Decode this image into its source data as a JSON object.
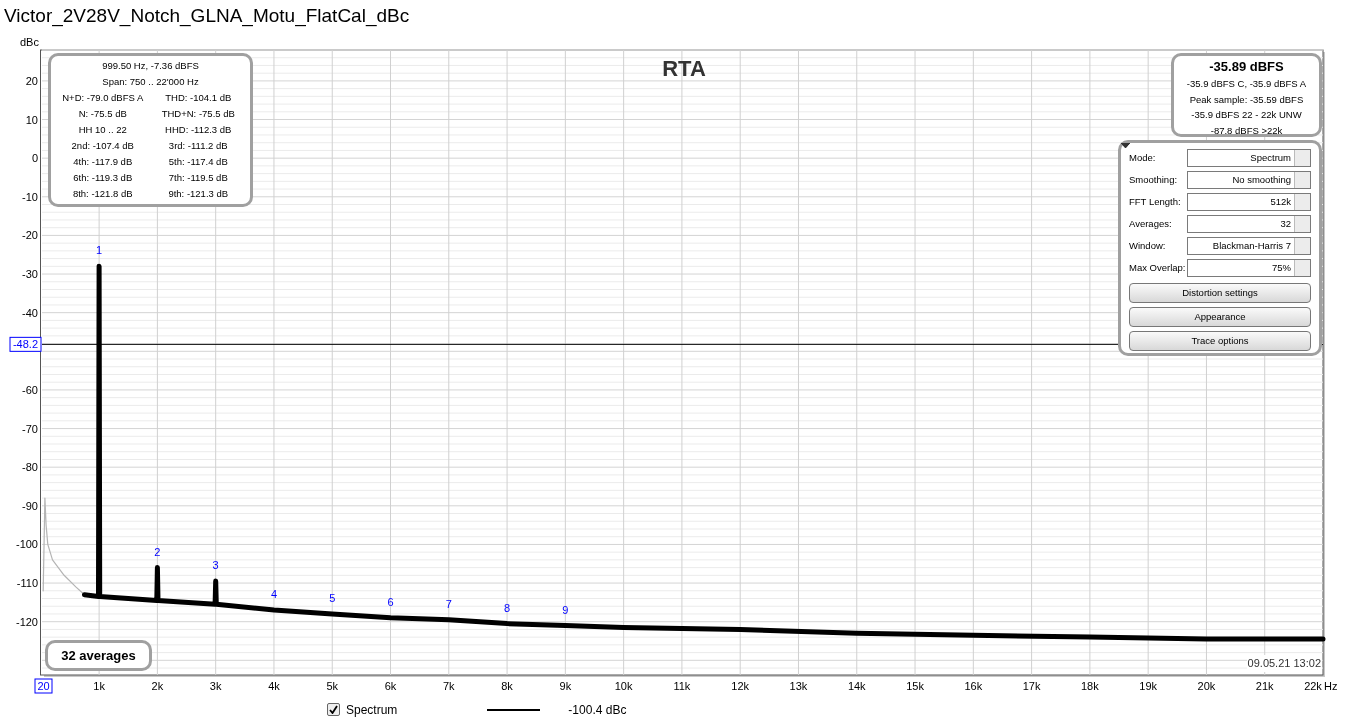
{
  "window": {
    "title": "Victor_2V28V_Notch_GLNA_Motu_FlatCal_dBc"
  },
  "plot": {
    "chart_data": {
      "type": "line",
      "title": "RTA",
      "ylabel": "dBc",
      "xlabel": "Hz",
      "grid": true,
      "xlim": [
        20,
        22000
      ],
      "ylim": [
        -133.8,
        28
      ],
      "xticks": [
        {
          "value": 20,
          "label": "20"
        },
        {
          "value": 1000,
          "label": "1k"
        },
        {
          "value": 2000,
          "label": "2k"
        },
        {
          "value": 3000,
          "label": "3k"
        },
        {
          "value": 4000,
          "label": "4k"
        },
        {
          "value": 5000,
          "label": "5k"
        },
        {
          "value": 6000,
          "label": "6k"
        },
        {
          "value": 7000,
          "label": "7k"
        },
        {
          "value": 8000,
          "label": "8k"
        },
        {
          "value": 9000,
          "label": "9k"
        },
        {
          "value": 10000,
          "label": "10k"
        },
        {
          "value": 11000,
          "label": "11k"
        },
        {
          "value": 12000,
          "label": "12k"
        },
        {
          "value": 13000,
          "label": "13k"
        },
        {
          "value": 14000,
          "label": "14k"
        },
        {
          "value": 15000,
          "label": "15k"
        },
        {
          "value": 16000,
          "label": "16k"
        },
        {
          "value": 17000,
          "label": "17k"
        },
        {
          "value": 18000,
          "label": "18k"
        },
        {
          "value": 19000,
          "label": "19k"
        },
        {
          "value": 20000,
          "label": "20k"
        },
        {
          "value": 21000,
          "label": "21k"
        },
        {
          "value": 22000,
          "label": "22k"
        }
      ],
      "yticks": [
        20,
        10,
        0,
        -10,
        -20,
        -30,
        -40,
        -60,
        -70,
        -80,
        -90,
        -100,
        -110,
        -120
      ],
      "series": [
        {
          "name": "Spectrum",
          "color": "#000000",
          "x": [
            750,
            990,
            1000,
            1010,
            1990,
            2000,
            2010,
            2990,
            3000,
            3010,
            4000,
            5000,
            6000,
            7000,
            8000,
            9000,
            10000,
            12000,
            14000,
            16000,
            18000,
            20000,
            22000
          ],
          "values": [
            -113,
            -113.5,
            -28,
            -113.5,
            -114.5,
            -106,
            -114.5,
            -115.5,
            -109.5,
            -115.5,
            -117,
            -118,
            -119,
            -119.5,
            -120.5,
            -121,
            -121.5,
            -122,
            -123,
            -123.5,
            -124,
            -124.5,
            -124.5
          ]
        },
        {
          "color": "#b4b4b4",
          "x": [
            40,
            70,
            90,
            120,
            200,
            400,
            600,
            750
          ],
          "values": [
            -112,
            -88,
            -95,
            -100,
            -104,
            -108,
            -111,
            -113
          ]
        }
      ],
      "ref_lines": [
        {
          "axis": "y",
          "value": -48.2,
          "label": "-48.2"
        }
      ],
      "annotations": [
        {
          "x": 1000,
          "y": -28,
          "text": "1"
        },
        {
          "x": 2000,
          "y": -106,
          "text": "2"
        },
        {
          "x": 3000,
          "y": -109.5,
          "text": "3"
        },
        {
          "x": 4000,
          "y": -117,
          "text": "4"
        },
        {
          "x": 5000,
          "y": -118,
          "text": "5"
        },
        {
          "x": 6000,
          "y": -119,
          "text": "6"
        },
        {
          "x": 7000,
          "y": -119.5,
          "text": "7"
        },
        {
          "x": 8000,
          "y": -120.5,
          "text": "8"
        },
        {
          "x": 9000,
          "y": -121,
          "text": "9"
        }
      ]
    },
    "info_box": {
      "lines": [
        "999.50 Hz, -7.36 dBFS",
        "Span: 750 .. 22'000 Hz"
      ],
      "pairs": [
        {
          "left": "N+D: -79.0 dBFS A",
          "right": "THD: -104.1 dB"
        },
        {
          "left": "N: -75.5 dB",
          "right": "THD+N: -75.5 dB"
        },
        {
          "left": "HH 10 .. 22",
          "right": "HHD: -112.3 dB"
        },
        {
          "left": "2nd: -107.4 dB",
          "right": "3rd: -111.2 dB"
        },
        {
          "left": "4th: -117.9 dB",
          "right": "5th: -117.4 dB"
        },
        {
          "left": "6th: -119.3 dB",
          "right": "7th: -119.5 dB"
        },
        {
          "left": "8th: -121.8 dB",
          "right": "9th: -121.3 dB"
        }
      ]
    },
    "level_box": {
      "headline": "-35.89 dBFS",
      "lines": [
        "-35.9 dBFS C, -35.9 dBFS A",
        "Peak sample: -35.59 dBFS",
        "-35.9 dBFS 22 - 22k UNW",
        "-87.8 dBFS >22k"
      ]
    },
    "controls": [
      {
        "label": "Mode:",
        "value": "Spectrum"
      },
      {
        "label": "Smoothing:",
        "value": "No  smoothing"
      },
      {
        "label": "FFT Length:",
        "value": "512k"
      },
      {
        "label": "Averages:",
        "value": "32"
      },
      {
        "label": "Window:",
        "value": "Blackman-Harris 7"
      },
      {
        "label": "Max Overlap:",
        "value": "75%"
      }
    ],
    "buttons": [
      "Distortion settings",
      "Appearance",
      "Trace options"
    ],
    "averages_badge": "32 averages",
    "timestamp": "09.05.21 13:02"
  },
  "legend": [
    {
      "checked": true,
      "reading": "-100.4 dBc"
    }
  ]
}
